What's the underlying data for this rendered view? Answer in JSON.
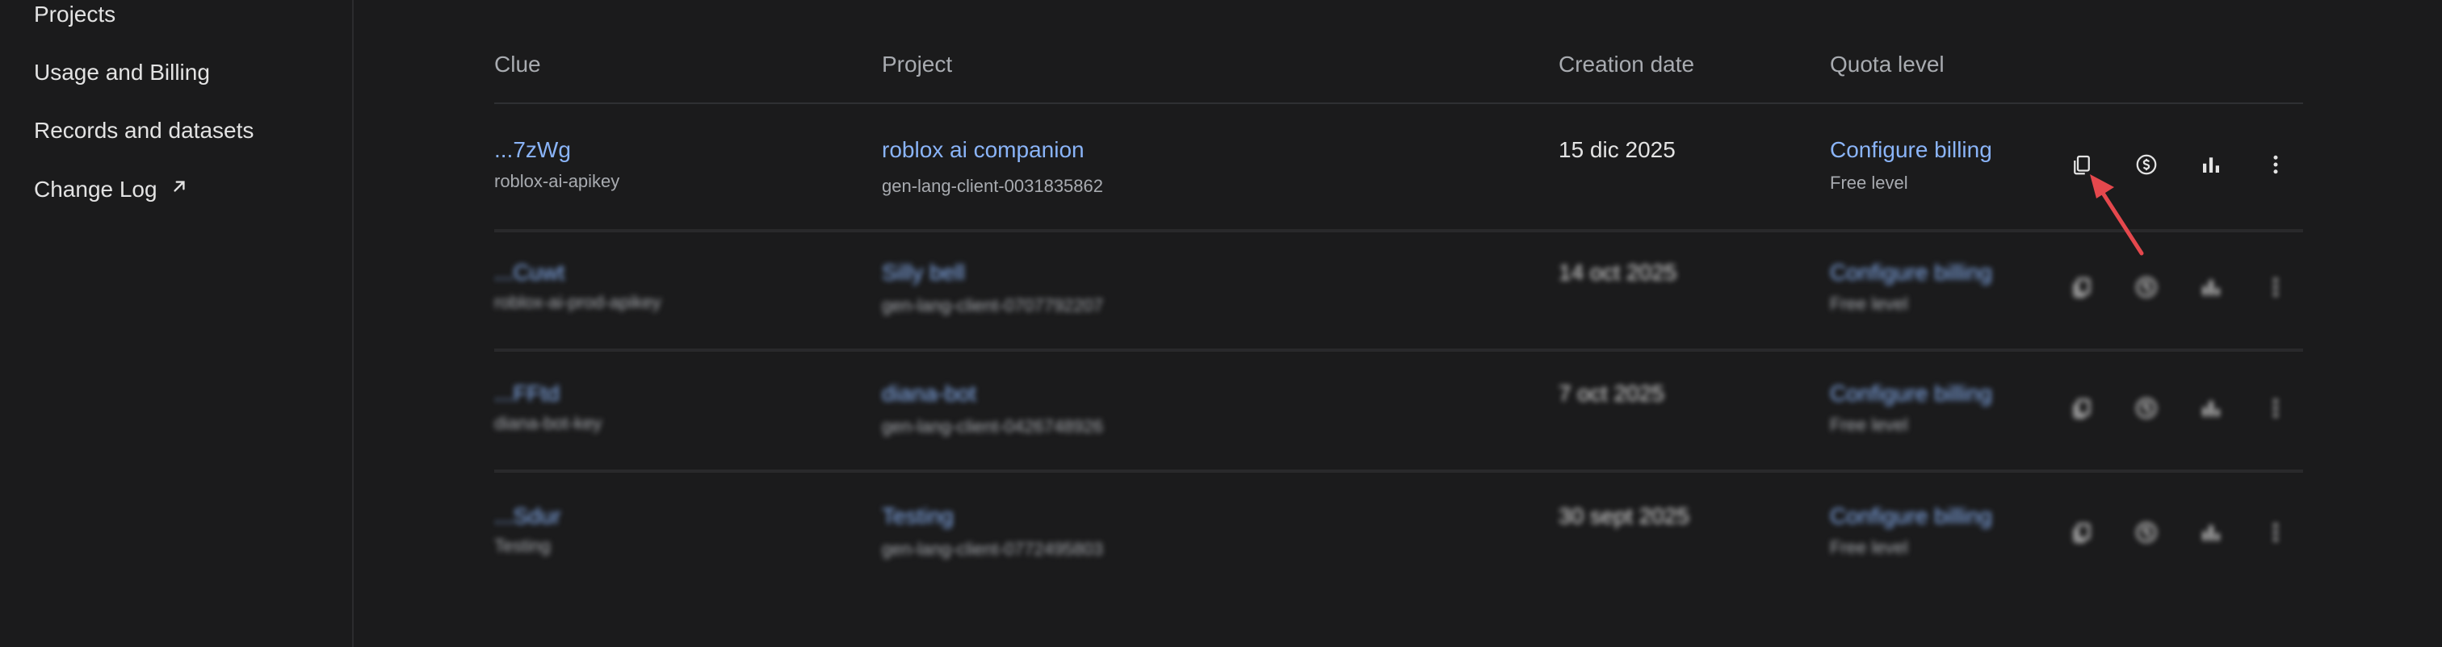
{
  "sidebar": {
    "items": [
      {
        "label": "Projects"
      },
      {
        "label": "Usage and Billing"
      },
      {
        "label": "Records and datasets"
      },
      {
        "label": "Change Log"
      }
    ]
  },
  "table": {
    "headers": {
      "clue": "Clue",
      "project": "Project",
      "creation_date": "Creation date",
      "quota_level": "Quota level"
    },
    "rows": [
      {
        "key": "...7zWg",
        "key_name": "roblox-ai-apikey",
        "project_name": "roblox ai companion",
        "project_id": "gen-lang-client-0031835862",
        "created": "15 dic 2025",
        "billing_link": "Configure billing",
        "tier": "Free level"
      },
      {
        "key": "...Cuwt",
        "key_name": "roblox-ai-prod-apikey",
        "project_name": "Silly bell",
        "project_id": "gen-lang-client-0707792207",
        "created": "14 oct 2025",
        "billing_link": "Configure billing",
        "tier": "Free level"
      },
      {
        "key": "...FFtd",
        "key_name": "diana-bot-key",
        "project_name": "diana-bot",
        "project_id": "gen-lang-client-0426748926",
        "created": "7 oct 2025",
        "billing_link": "Configure billing",
        "tier": "Free level"
      },
      {
        "key": "...Sdur",
        "key_name": "Testing",
        "project_name": "Testing",
        "project_id": "gen-lang-client-0772495803",
        "created": "30 sept 2025",
        "billing_link": "Configure billing",
        "tier": "Free level"
      }
    ],
    "action_icons": [
      "copy-icon",
      "dollar-circle-icon",
      "bar-chart-icon",
      "more-vert-icon"
    ]
  },
  "colors": {
    "background": "#1b1b1c",
    "link": "#8ab4f8",
    "muted": "#a8abb0",
    "annotation_arrow": "#e5484d"
  }
}
